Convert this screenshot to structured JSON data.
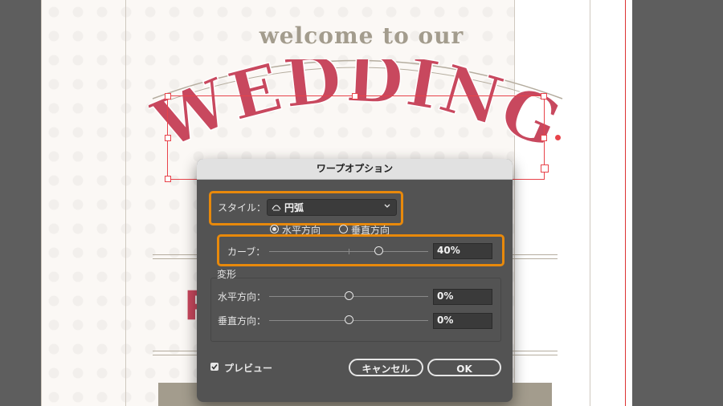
{
  "artwork": {
    "welcome_text": "welcome to our",
    "wedding_text": "WEDDING",
    "partial_letter": "P",
    "colors": {
      "wedding_red": "#c8485e",
      "welcome_taupe": "#a39c8d",
      "selection_red": "#e8434a",
      "highlight_orange": "#e8890b"
    }
  },
  "dialog": {
    "title": "ワープオプション",
    "style_label": "スタイル：",
    "style_value": "円弧",
    "style_icon": "arc-icon",
    "horizontal_radio": "水平方向",
    "vertical_radio": "垂直方向",
    "selected_orientation": "horizontal",
    "curve_label": "カーブ：",
    "curve_value": "40%",
    "distortion_group_label": "変形",
    "distort_h_label": "水平方向：",
    "distort_h_value": "0%",
    "distort_v_label": "垂直方向：",
    "distort_v_value": "0%",
    "preview_label": "プレビュー",
    "preview_checked": true,
    "cancel_label": "キャンセル",
    "ok_label": "OK"
  }
}
